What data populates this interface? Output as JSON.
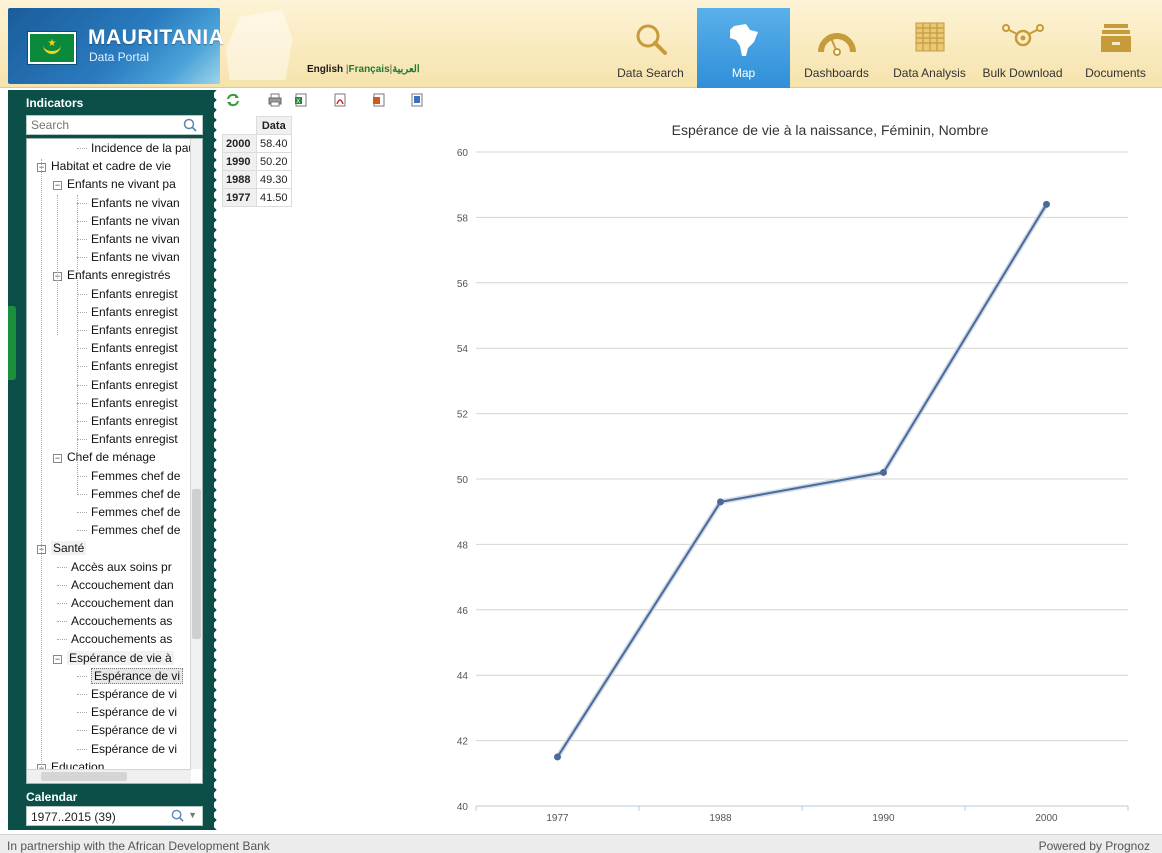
{
  "header": {
    "country": "MAURITANIA",
    "subtitle": "Data Portal",
    "languages": [
      "English",
      "Français",
      "العربية"
    ]
  },
  "nav": [
    {
      "label": "Data Search",
      "icon": "search-icon",
      "selected": false
    },
    {
      "label": "Map",
      "icon": "africa-map-icon",
      "selected": true
    },
    {
      "label": "Dashboards",
      "icon": "gauge-icon",
      "selected": false
    },
    {
      "label": "Data Analysis",
      "icon": "table-grid-icon",
      "selected": false
    },
    {
      "label": "Bulk Download",
      "icon": "network-nodes-icon",
      "selected": false
    },
    {
      "label": "Documents",
      "icon": "document-stack-icon",
      "selected": false
    }
  ],
  "sidebar": {
    "title": "Indicators",
    "search_placeholder": "Search",
    "tree": [
      {
        "text": "Incidence de la pau",
        "level": 2,
        "expander": false
      },
      {
        "text": "Habitat et cadre de vie",
        "level": 0,
        "expander": true
      },
      {
        "text": "Enfants ne vivant pa",
        "level": 1,
        "expander": true
      },
      {
        "text": "Enfants ne vivan",
        "level": 2,
        "expander": false
      },
      {
        "text": "Enfants ne vivan",
        "level": 2,
        "expander": false
      },
      {
        "text": "Enfants ne vivan",
        "level": 2,
        "expander": false
      },
      {
        "text": "Enfants ne vivan",
        "level": 2,
        "expander": false
      },
      {
        "text": "Enfants enregistrés",
        "level": 1,
        "expander": true
      },
      {
        "text": "Enfants enregist",
        "level": 2,
        "expander": false
      },
      {
        "text": "Enfants enregist",
        "level": 2,
        "expander": false
      },
      {
        "text": "Enfants enregist",
        "level": 2,
        "expander": false
      },
      {
        "text": "Enfants enregist",
        "level": 2,
        "expander": false
      },
      {
        "text": "Enfants enregist",
        "level": 2,
        "expander": false
      },
      {
        "text": "Enfants enregist",
        "level": 2,
        "expander": false
      },
      {
        "text": "Enfants enregist",
        "level": 2,
        "expander": false
      },
      {
        "text": "Enfants enregist",
        "level": 2,
        "expander": false
      },
      {
        "text": "Enfants enregist",
        "level": 2,
        "expander": false
      },
      {
        "text": "Chef de ménage",
        "level": 1,
        "expander": true
      },
      {
        "text": "Femmes chef de",
        "level": 2,
        "expander": false
      },
      {
        "text": "Femmes chef de",
        "level": 2,
        "expander": false
      },
      {
        "text": "Femmes chef de",
        "level": 2,
        "expander": false
      },
      {
        "text": "Femmes chef de",
        "level": 2,
        "expander": false
      },
      {
        "text": "Santé",
        "level": 0,
        "expander": true,
        "group": true
      },
      {
        "text": "Accès aux soins pr",
        "level": 1,
        "expander": false
      },
      {
        "text": "Accouchement dan",
        "level": 1,
        "expander": false
      },
      {
        "text": "Accouchement dan",
        "level": 1,
        "expander": false
      },
      {
        "text": "Accouchements as",
        "level": 1,
        "expander": false
      },
      {
        "text": "Accouchements as",
        "level": 1,
        "expander": false
      },
      {
        "text": "Espérance de vie à",
        "level": 1,
        "expander": true,
        "group": true
      },
      {
        "text": "Espérance de vi",
        "level": 2,
        "expander": false,
        "selected": true
      },
      {
        "text": "Espérance de vi",
        "level": 2,
        "expander": false
      },
      {
        "text": "Espérance de vi",
        "level": 2,
        "expander": false
      },
      {
        "text": "Espérance de vi",
        "level": 2,
        "expander": false
      },
      {
        "text": "Espérance de vi",
        "level": 2,
        "expander": false
      },
      {
        "text": "Education",
        "level": 0,
        "expander": true
      }
    ],
    "calendar_title": "Calendar",
    "calendar_value": "1977..2015 (39)"
  },
  "toolbar": {
    "icons": [
      "refresh-icon",
      "print-icon",
      "excel-export-icon",
      "pdf-export-icon",
      "powerpoint-export-icon",
      "word-export-icon"
    ]
  },
  "table": {
    "header": "Data",
    "rows": [
      {
        "year": "2000",
        "value": "58.40"
      },
      {
        "year": "1990",
        "value": "50.20"
      },
      {
        "year": "1988",
        "value": "49.30"
      },
      {
        "year": "1977",
        "value": "41.50"
      }
    ]
  },
  "chart_data": {
    "type": "line",
    "title": "Espérance de vie à la naissance, Féminin, Nombre",
    "categories": [
      "1977",
      "1988",
      "1990",
      "2000"
    ],
    "series": [
      {
        "values": [
          41.5,
          49.3,
          50.2,
          58.4
        ]
      }
    ],
    "ylim": [
      40,
      60
    ],
    "yticks": [
      40,
      42,
      44,
      46,
      48,
      50,
      52,
      54,
      56,
      58,
      60
    ],
    "grid": true,
    "line_color": "#4a6a9a"
  },
  "footer": {
    "left": "In partnership with the African Development Bank",
    "right": "Powered by Prognoz"
  }
}
